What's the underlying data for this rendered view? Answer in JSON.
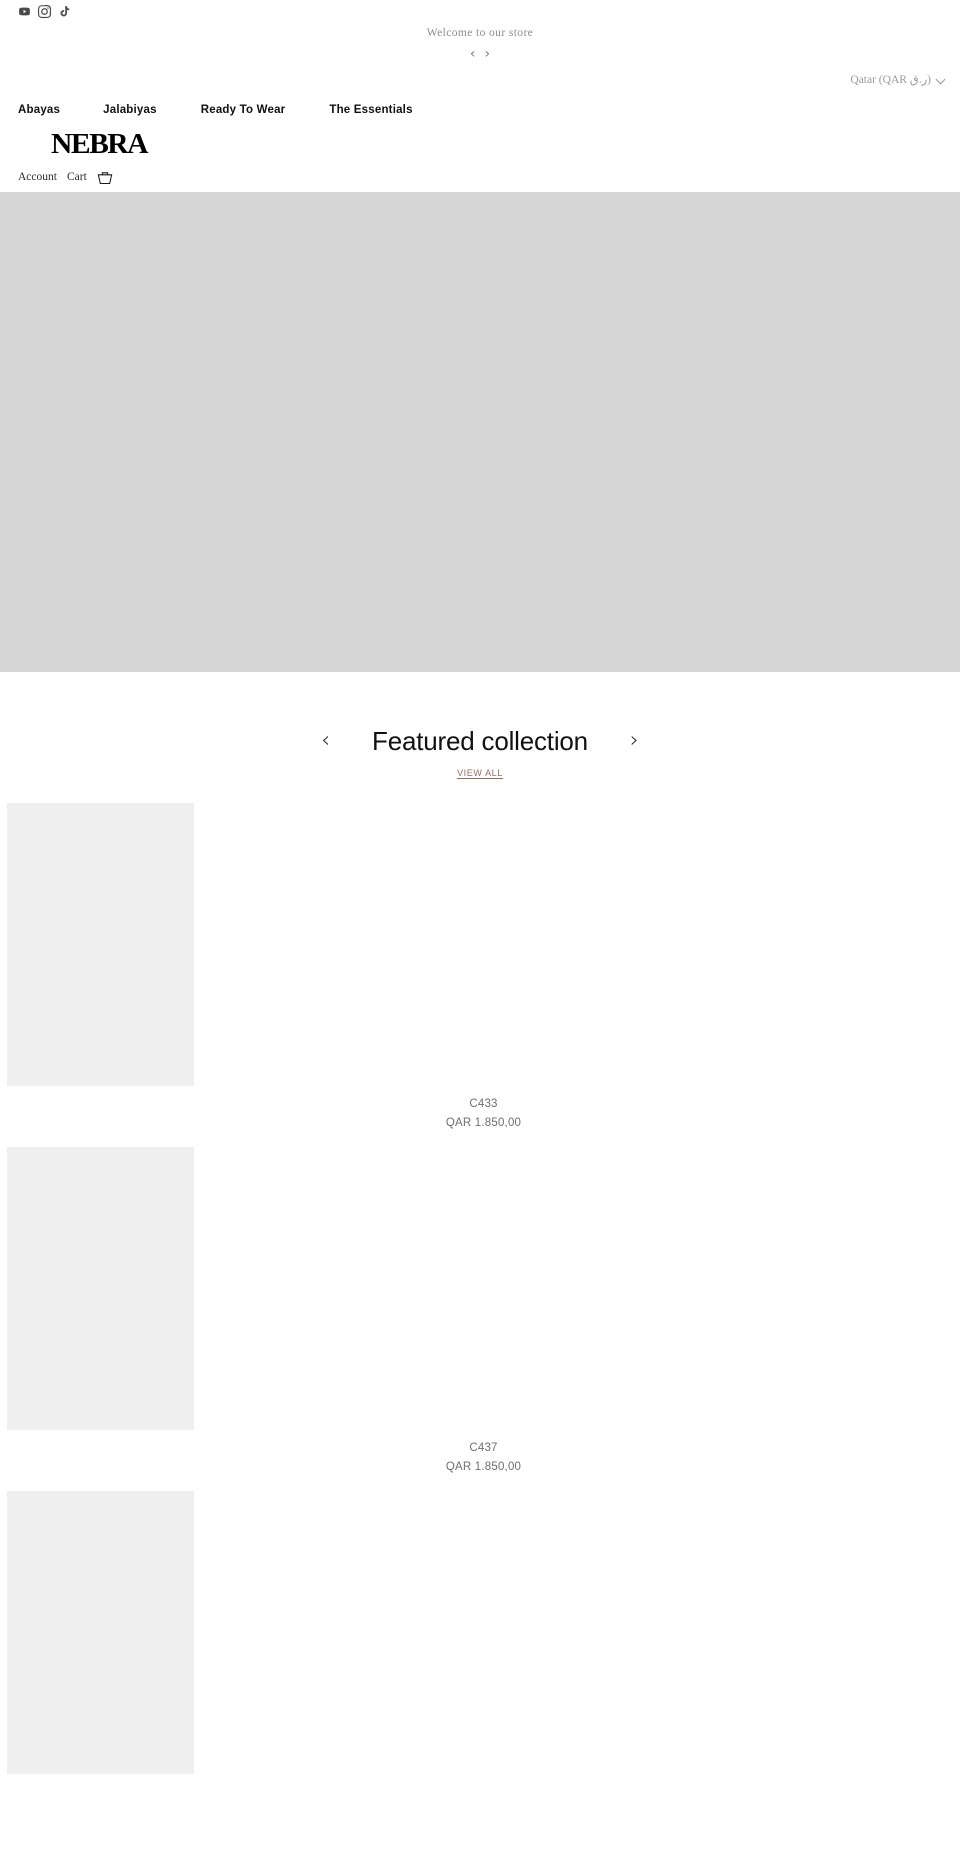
{
  "topbar": {
    "social": [
      {
        "name": "youtube-icon",
        "label": "YouTube"
      },
      {
        "name": "instagram-icon",
        "label": "Instagram"
      },
      {
        "name": "tiktok-icon",
        "label": "TikTok"
      }
    ]
  },
  "announcement": {
    "text": "Welcome to our store",
    "prev_label": "‹",
    "next_label": "›"
  },
  "currency": {
    "selected": "Qatar (QAR ر.ق)"
  },
  "nav": {
    "items": [
      {
        "label": "Abayas"
      },
      {
        "label": "Jalabiyas"
      },
      {
        "label": "Ready To Wear"
      },
      {
        "label": "The Essentials"
      }
    ]
  },
  "brand": {
    "logo_text": "NEBRA"
  },
  "utility": {
    "account_label": "Account",
    "cart_label": "Cart"
  },
  "featured": {
    "title": "Featured collection",
    "prev_label": "‹",
    "next_label": "›",
    "view_all_label": "VIEW ALL",
    "products": [
      {
        "title": "C433",
        "price": "QAR 1.850,00"
      },
      {
        "title": "C437",
        "price": "QAR 1.850,00"
      },
      {
        "title": "",
        "price": ""
      }
    ]
  },
  "colors": {
    "accent_link": "#9a6b5e",
    "hero_placeholder": "#d6d6d6",
    "product_placeholder": "#efefef",
    "text_muted": "#6e6e6e"
  }
}
